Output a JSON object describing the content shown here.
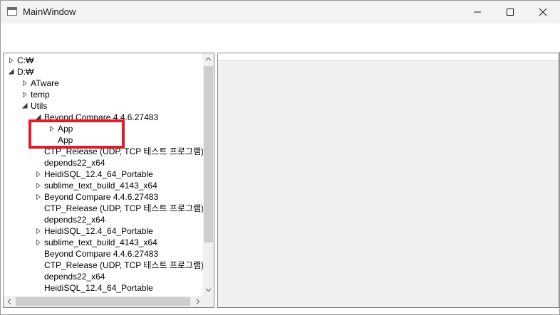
{
  "window": {
    "title": "MainWindow",
    "icon": "app-window-icon"
  },
  "titlebar": {
    "minimize_icon": "minimize-icon",
    "maximize_icon": "maximize-icon",
    "close_icon": "close-icon"
  },
  "tree": {
    "rows": [
      {
        "label": "C:₩",
        "depth": 0,
        "arrow": "collapsed"
      },
      {
        "label": "D:₩",
        "depth": 0,
        "arrow": "expanded"
      },
      {
        "label": "ATware",
        "depth": 1,
        "arrow": "collapsed"
      },
      {
        "label": "temp",
        "depth": 1,
        "arrow": "collapsed"
      },
      {
        "label": "Utils",
        "depth": 1,
        "arrow": "expanded"
      },
      {
        "label": "Beyond Compare 4.4.6.27483",
        "depth": 2,
        "arrow": "expanded"
      },
      {
        "label": "App",
        "depth": 3,
        "arrow": "collapsed"
      },
      {
        "label": "App",
        "depth": 3,
        "arrow": "none"
      },
      {
        "label": "CTP_Release (UDP, TCP 테스트 프로그램)",
        "depth": 2,
        "arrow": "none"
      },
      {
        "label": "depends22_x64",
        "depth": 2,
        "arrow": "none"
      },
      {
        "label": "HeidiSQL_12.4_64_Portable",
        "depth": 2,
        "arrow": "collapsed"
      },
      {
        "label": "sublime_text_build_4143_x64",
        "depth": 2,
        "arrow": "collapsed"
      },
      {
        "label": "Beyond Compare 4.4.6.27483",
        "depth": 2,
        "arrow": "collapsed"
      },
      {
        "label": "CTP_Release (UDP, TCP 테스트 프로그램)",
        "depth": 2,
        "arrow": "none"
      },
      {
        "label": "depends22_x64",
        "depth": 2,
        "arrow": "none"
      },
      {
        "label": "HeidiSQL_12.4_64_Portable",
        "depth": 2,
        "arrow": "collapsed"
      },
      {
        "label": "sublime_text_build_4143_x64",
        "depth": 2,
        "arrow": "collapsed"
      },
      {
        "label": "Beyond Compare 4.4.6.27483",
        "depth": 2,
        "arrow": "none"
      },
      {
        "label": "CTP_Release (UDP, TCP 테스트 프로그램)",
        "depth": 2,
        "arrow": "none"
      },
      {
        "label": "depends22_x64",
        "depth": 2,
        "arrow": "none"
      },
      {
        "label": "HeidiSQL_12.4_64_Portable",
        "depth": 2,
        "arrow": "none"
      }
    ]
  },
  "colors": {
    "highlight": "#e5192a",
    "titlebar": "#f3f3f3",
    "panel_bg": "#f0f0f0"
  }
}
